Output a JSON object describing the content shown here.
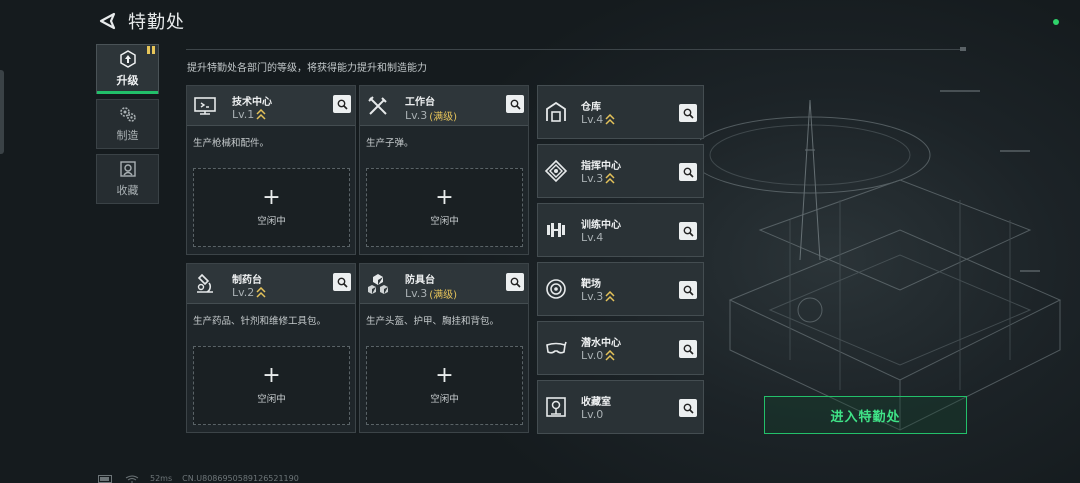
{
  "header": {
    "title": "特勤处"
  },
  "sidebar": {
    "tabs": [
      {
        "label": "升级",
        "icon": "upgrade-icon",
        "active": true
      },
      {
        "label": "制造",
        "icon": "gears-icon",
        "active": false
      },
      {
        "label": "收藏",
        "icon": "collection-icon",
        "active": false
      }
    ]
  },
  "subtitle": "提升特勤处各部门的等级，将获得能力提升和制造能力",
  "large_departments": [
    {
      "name": "技术中心",
      "level": "Lv.1",
      "max_tag": "",
      "upgradeable": true,
      "icon": "monitor-icon",
      "desc": "生产枪械和配件。",
      "slot_label": "空闲中"
    },
    {
      "name": "工作台",
      "level": "Lv.3",
      "max_tag": "(满级)",
      "upgradeable": false,
      "icon": "tools-icon",
      "desc": "生产子弹。",
      "slot_label": "空闲中"
    },
    {
      "name": "制药台",
      "level": "Lv.2",
      "max_tag": "",
      "upgradeable": true,
      "icon": "microscope-icon",
      "desc": "生产药品、针剂和维修工具包。",
      "slot_label": "空闲中"
    },
    {
      "name": "防具台",
      "level": "Lv.3",
      "max_tag": "(满级)",
      "upgradeable": false,
      "icon": "armor-boxes-icon",
      "desc": "生产头盔、护甲、胸挂和背包。",
      "slot_label": "空闲中"
    }
  ],
  "small_departments": [
    {
      "name": "仓库",
      "level": "Lv.4",
      "upgradeable": true,
      "icon": "warehouse-icon"
    },
    {
      "name": "指挥中心",
      "level": "Lv.3",
      "upgradeable": true,
      "icon": "command-center-icon"
    },
    {
      "name": "训练中心",
      "level": "Lv.4",
      "upgradeable": false,
      "icon": "dumbbell-icon"
    },
    {
      "name": "靶场",
      "level": "Lv.3",
      "upgradeable": true,
      "icon": "target-icon"
    },
    {
      "name": "潜水中心",
      "level": "Lv.0",
      "upgradeable": true,
      "icon": "diving-mask-icon"
    },
    {
      "name": "收藏室",
      "level": "Lv.0",
      "upgradeable": false,
      "icon": "collection-room-icon"
    }
  ],
  "enter_button": "进入特勤处",
  "footer": {
    "ping": "52ms",
    "id": "CN.U8086950589126521190"
  },
  "colors": {
    "accent_green": "#23c06a",
    "gold": "#e4c25a",
    "status_dot": "#2fd36a"
  }
}
